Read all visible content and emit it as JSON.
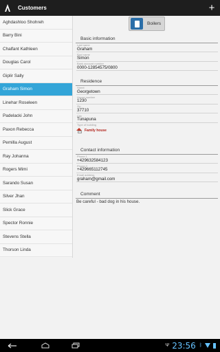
{
  "app": {
    "title": "Customers",
    "add_icon": "plus-icon",
    "home_icon": "app-logo-icon"
  },
  "customers": [
    "Aghdashloo Shohreh",
    "Barry Bini",
    "Chalfant Kathleen",
    "Douglas Carol",
    "Giplir Sally",
    "Graham Simon",
    "Linehar Roseleen",
    "Padelacki John",
    "Paxon Rebecca",
    "Pemilla August",
    "Ray Johanna",
    "Rogers Mimi",
    "Sarando Susan",
    "Silver Jhan",
    "Slick Grace",
    "Spector Ronnie",
    "Stevens Stella",
    "Thorson Linda"
  ],
  "selected_customer": "Graham Simon",
  "boilers_button": {
    "label": "Boilers",
    "icon": "boiler-icon"
  },
  "basic": {
    "title": "Basic information",
    "last_name_caption": "Last name",
    "last_name": "Graham",
    "first_name_caption": "First name",
    "first_name": "Simon",
    "account_caption": "Bank account number",
    "account": "0000-12854575/0800"
  },
  "residence": {
    "title": "Residence",
    "street_caption": "Street",
    "street": "Georgetown",
    "house_caption": "House number",
    "house": "1230",
    "zip_caption": "Zip",
    "zip": "37710",
    "city_caption": "City",
    "city": "Tunapuna",
    "type_caption": "Type of building",
    "type": "Family house",
    "type_icon": "house-icon"
  },
  "contact": {
    "title": "Contact information",
    "phone1_caption": "Phone 1",
    "phone1": "+429632584123",
    "phone2_caption": "Phone 2",
    "phone2": "+429665112745",
    "email_caption": "Email address",
    "email": "graham@gmail.com"
  },
  "comment": {
    "title": "Comment",
    "text": "Be careful - bad dog in his house."
  },
  "system": {
    "time": "23:56",
    "colors": {
      "accent": "#33a5d8",
      "clock": "#66c2ff"
    }
  }
}
